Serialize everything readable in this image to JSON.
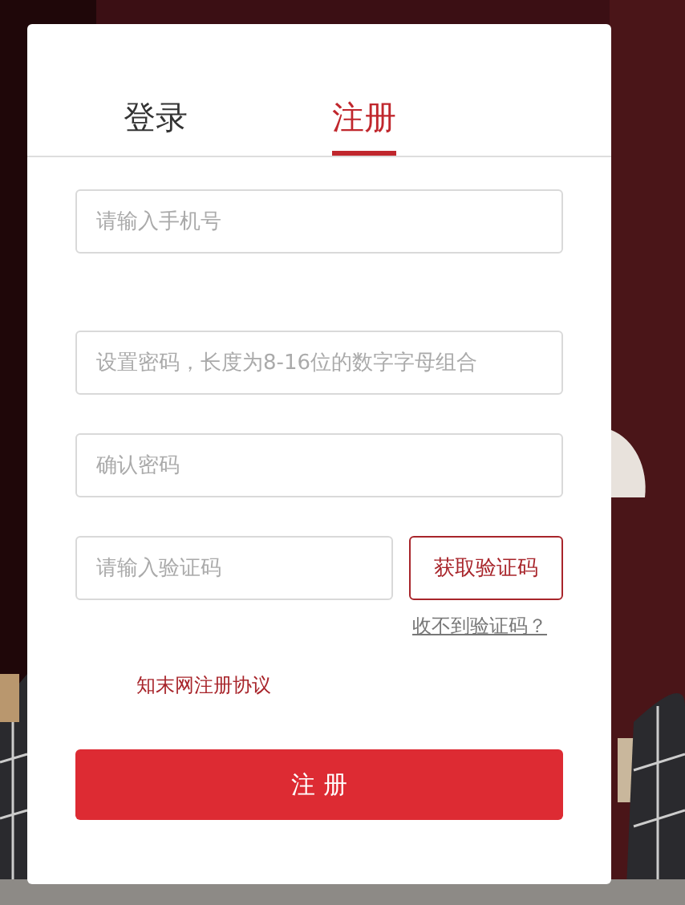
{
  "tabs": [
    {
      "label": "登录",
      "selected": false
    },
    {
      "label": "注册",
      "selected": true
    }
  ],
  "fields": [
    {
      "placeholder": "请输入手机号"
    },
    {
      "placeholder": "设置密码，长度为8-16位的数字字母组合"
    },
    {
      "placeholder": "确认密码"
    }
  ],
  "code_field": {
    "placeholder": "请输入验证码"
  },
  "get_code_button": "获取验证码",
  "resend_link": "收不到验证码？",
  "agreement_link": "知末网注册协议",
  "submit_button": "注 册"
}
